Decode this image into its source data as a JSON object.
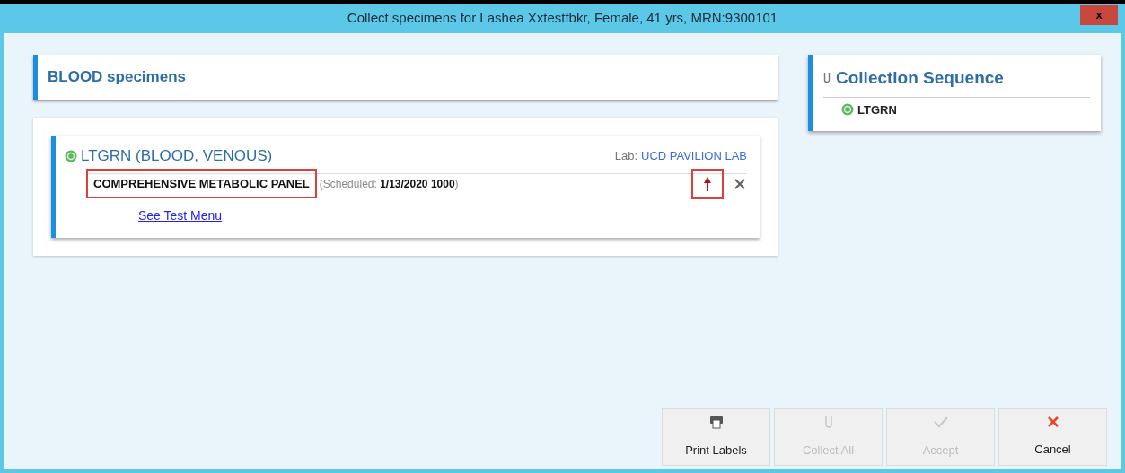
{
  "window": {
    "title": "Collect specimens for Lashea Xxtestfbkr, Female, 41 yrs,  MRN:9300101",
    "close": "x"
  },
  "specimens_panel": {
    "title": "BLOOD specimens",
    "containers": [
      {
        "name": "LTGRN (BLOOD, VENOUS)",
        "color": "#5cb85c",
        "lab_label": "Lab:",
        "lab": "UCD PAVILION LAB",
        "tests": [
          {
            "name": "COMPREHENSIVE METABOLIC PANEL",
            "highlighted": true,
            "scheduled_open": "(Scheduled: ",
            "scheduled": "1/13/2020 1000",
            "scheduled_close": ")",
            "priority_highlighted": true
          }
        ],
        "link": "See Test Menu"
      }
    ]
  },
  "sequence_panel": {
    "title": "Collection Sequence",
    "items": [
      {
        "name": "LTGRN",
        "color": "#5cb85c"
      }
    ]
  },
  "buttons": [
    {
      "kind": "print",
      "label": "Print Labels",
      "disabled": false
    },
    {
      "kind": "tube",
      "label": "Collect All",
      "disabled": true
    },
    {
      "kind": "check",
      "label": "Accept",
      "disabled": true
    },
    {
      "kind": "cancel",
      "label": "Cancel",
      "disabled": false
    }
  ]
}
